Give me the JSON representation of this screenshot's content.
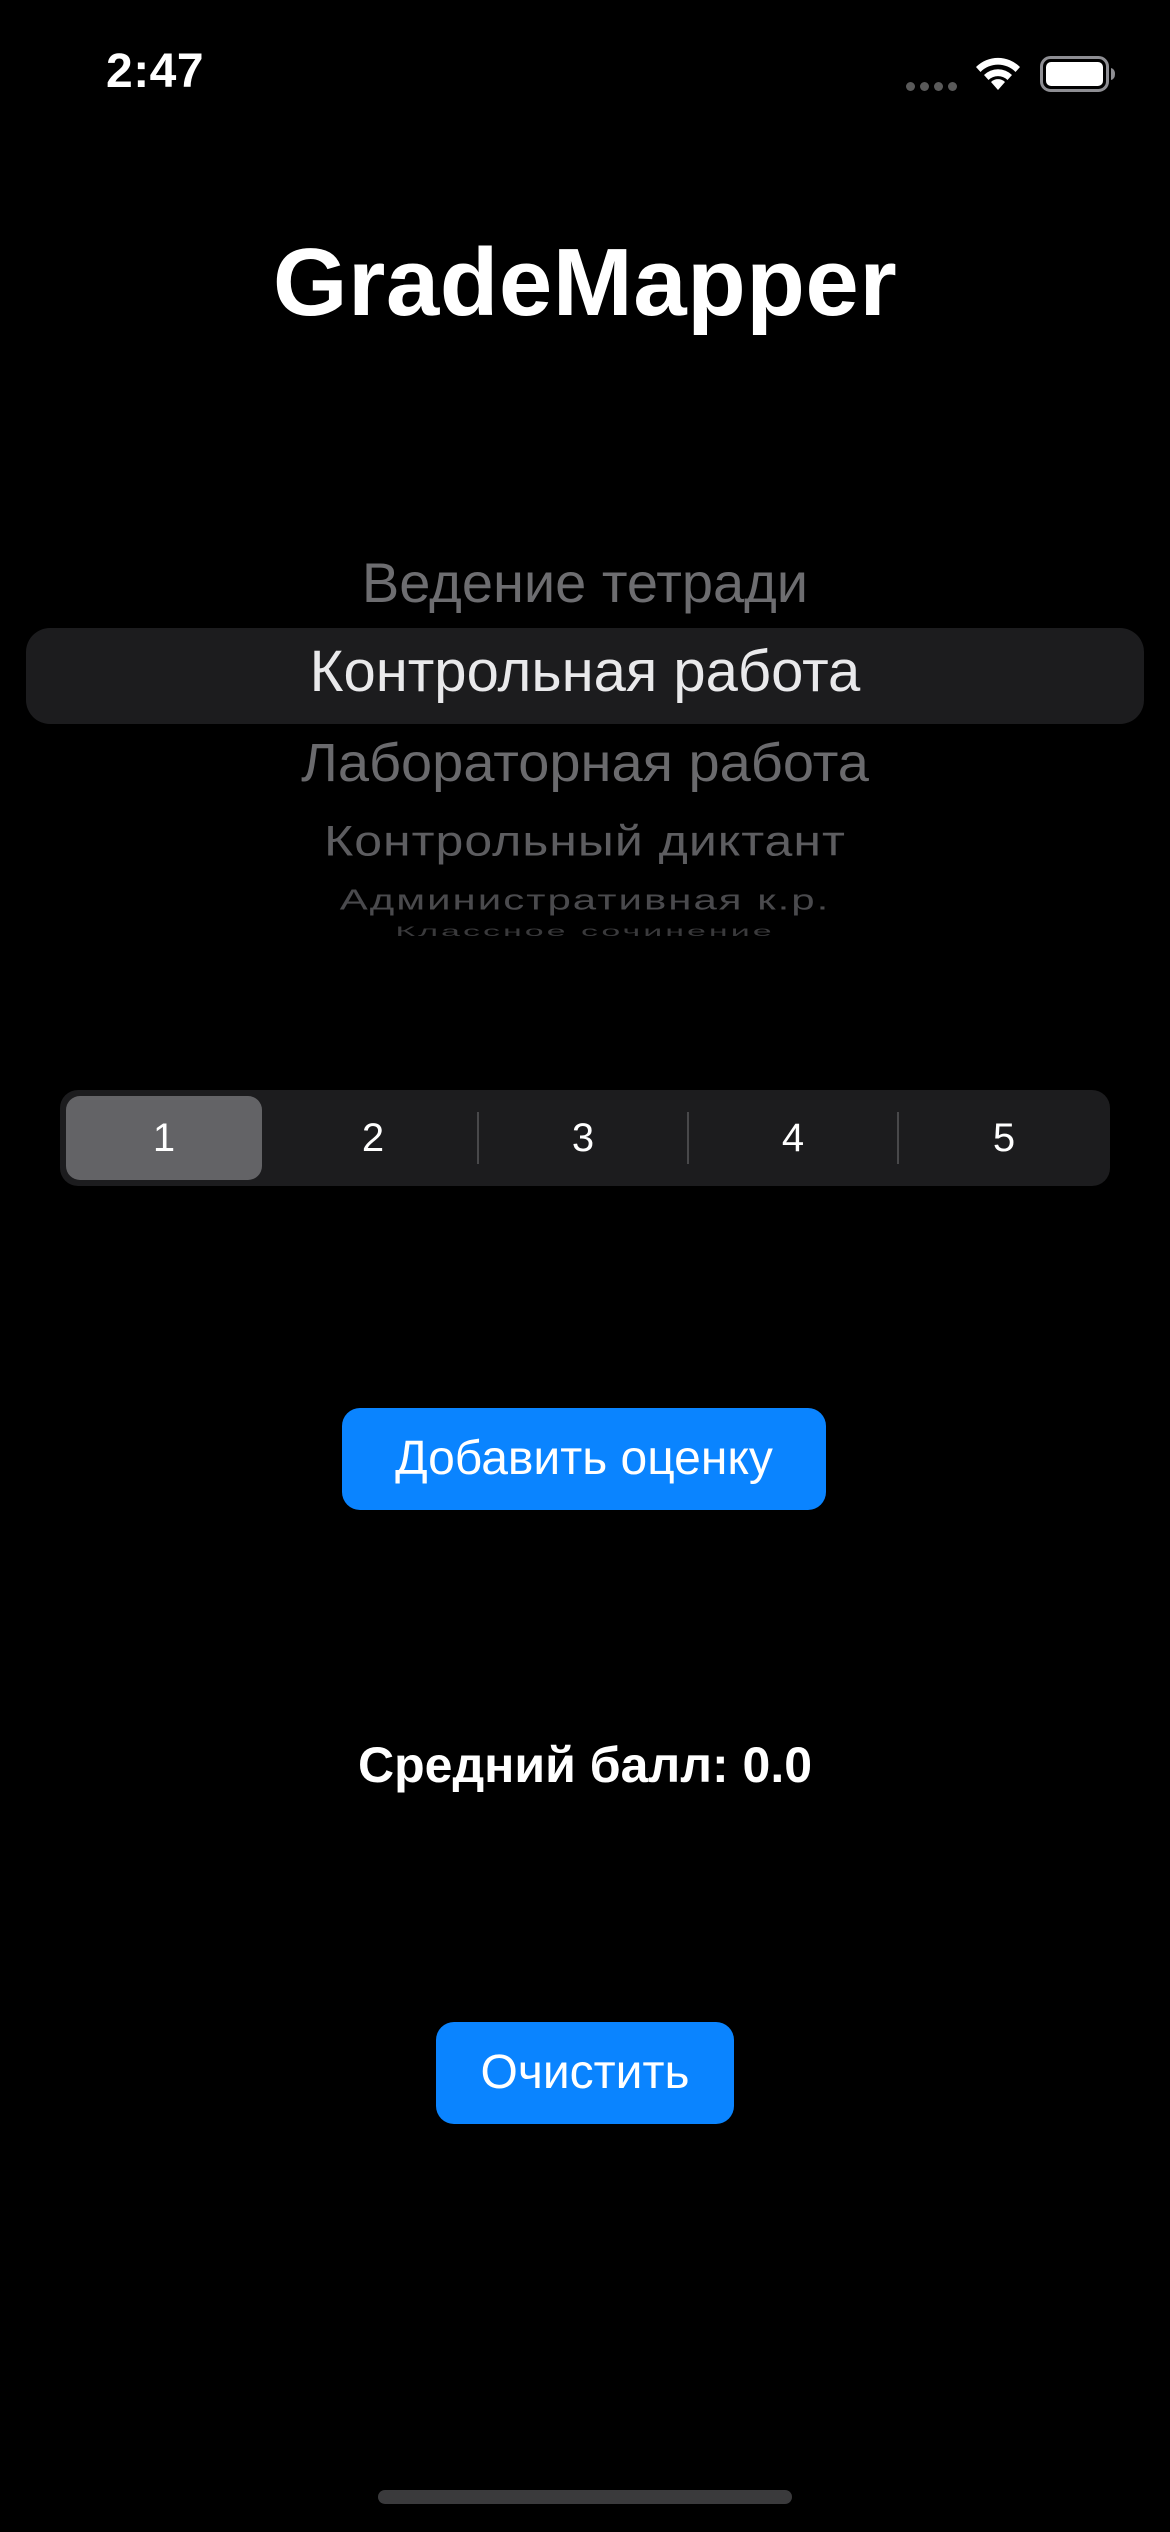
{
  "status_bar": {
    "time": "2:47",
    "icons": [
      "cellular-signal-icon",
      "wifi-icon",
      "battery-icon"
    ]
  },
  "app": {
    "title": "GradeMapper"
  },
  "picker": {
    "items": [
      "Ведение тетради",
      "Контрольная работа",
      "Лабораторная работа",
      "Контрольный диктант",
      "Административная к.р.",
      "Классное сочинение"
    ],
    "selected": "Контрольная работа"
  },
  "grade_segments": {
    "options": [
      "1",
      "2",
      "3",
      "4",
      "5"
    ],
    "selected": "1"
  },
  "buttons": {
    "add_grade": "Добавить оценку",
    "clear": "Очистить"
  },
  "average": {
    "text": "Средний балл: 0.0"
  },
  "colors": {
    "background": "#000000",
    "accent": "#0a84ff",
    "segment_selected": "#636366",
    "control_background": "#1c1c1e"
  }
}
